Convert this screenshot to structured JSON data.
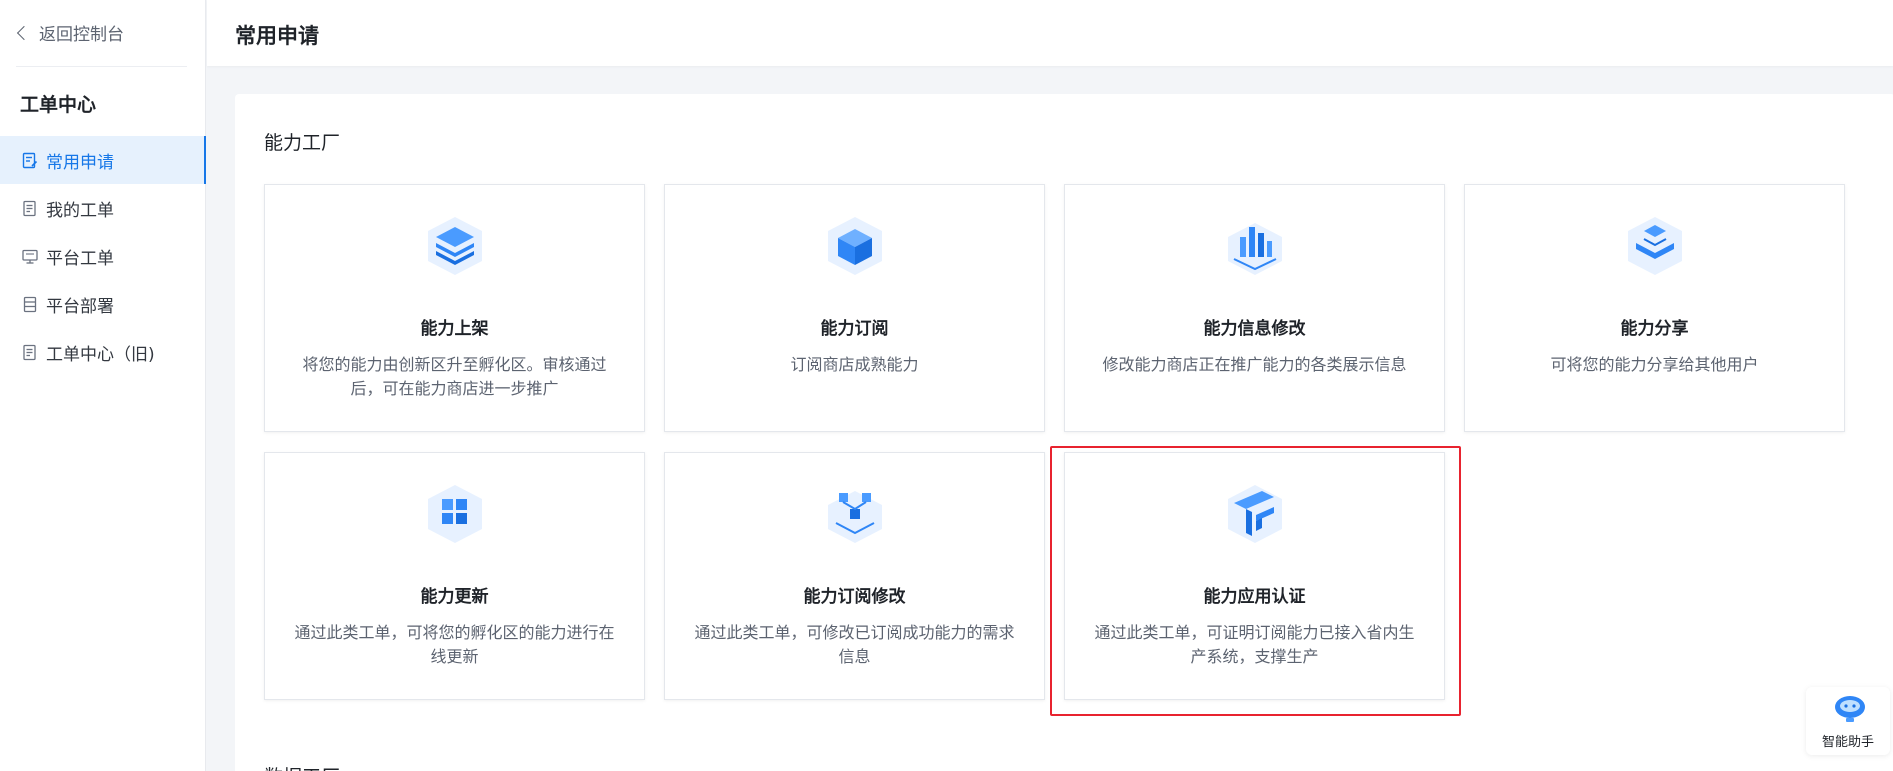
{
  "sidebar": {
    "back_label": "返回控制台",
    "title": "工单中心",
    "items": [
      {
        "label": "常用申请",
        "icon": "form-icon",
        "active": true
      },
      {
        "label": "我的工单",
        "icon": "document-icon",
        "active": false
      },
      {
        "label": "平台工单",
        "icon": "monitor-icon",
        "active": false
      },
      {
        "label": "平台部署",
        "icon": "server-icon",
        "active": false
      },
      {
        "label": "工单中心（旧)",
        "icon": "document-icon",
        "active": false
      }
    ]
  },
  "header": {
    "title": "常用申请"
  },
  "sections": [
    {
      "title": "能力工厂",
      "cards": [
        {
          "title": "能力上架",
          "desc": "将您的能力由创新区升至孵化区。审核通过后，可在能力商店进一步推广",
          "icon": "layers-stack-icon"
        },
        {
          "title": "能力订阅",
          "desc": "订阅商店成熟能力",
          "icon": "cube-icon"
        },
        {
          "title": "能力信息修改",
          "desc": "修改能力商店正在推广能力的各类展示信息",
          "icon": "bar-chart-cube-icon"
        },
        {
          "title": "能力分享",
          "desc": "可将您的能力分享给其他用户",
          "icon": "share-cube-icon"
        },
        {
          "title": "能力更新",
          "desc": "通过此类工单，可将您的孵化区的能力进行在线更新",
          "icon": "grid-cube-icon"
        },
        {
          "title": "能力订阅修改",
          "desc": "通过此类工单，可修改已订阅成功能力的需求信息",
          "icon": "network-cube-icon"
        },
        {
          "title": "能力应用认证",
          "desc": "通过此类工单，可证明订阅能力已接入省内生产系统，支撑生产",
          "icon": "certificate-cube-icon",
          "highlighted": true
        }
      ]
    },
    {
      "title": "数据工厂"
    }
  ],
  "assistant": {
    "label": "智能助手",
    "icon": "robot-icon"
  },
  "colors": {
    "accent": "#1677e8",
    "highlight": "#e8232f",
    "icon_blue": "#2f86f6"
  }
}
